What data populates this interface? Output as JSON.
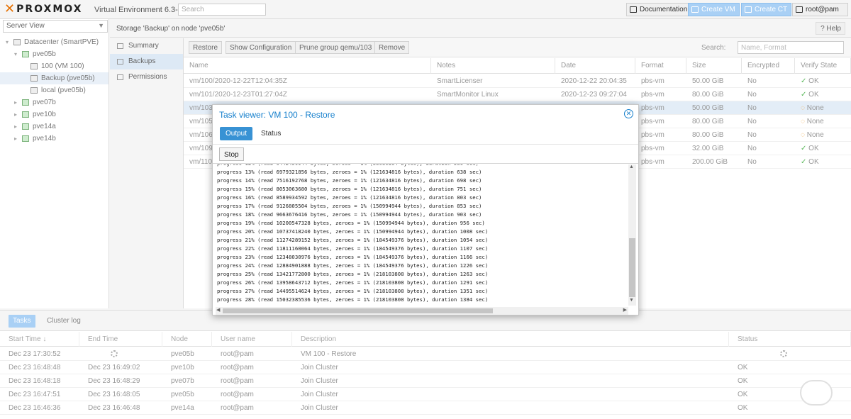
{
  "app": {
    "logo_x": "✕",
    "logo_brand": "PROXMOX",
    "version": "Virtual Environment 6.3-3",
    "search_placeholder": "Search"
  },
  "header": {
    "documentation": "Documentation",
    "create_vm": "Create VM",
    "create_ct": "Create CT",
    "user": "root@pam"
  },
  "sidebar": {
    "view": "Server View",
    "tree": [
      {
        "label": "Datacenter (SmartPVE)",
        "level": 0
      },
      {
        "label": "pve05b",
        "level": 1
      },
      {
        "label": "100 (VM 100)",
        "level": 2
      },
      {
        "label": "Backup (pve05b)",
        "level": 2,
        "selected": true
      },
      {
        "label": "local (pve05b)",
        "level": 2
      },
      {
        "label": "pve07b",
        "level": 1
      },
      {
        "label": "pve10b",
        "level": 1
      },
      {
        "label": "pve14a",
        "level": 1
      },
      {
        "label": "pve14b",
        "level": 1
      }
    ]
  },
  "breadcrumb": "Storage 'Backup' on node 'pve05b'",
  "help": "Help",
  "submenu": [
    "Summary",
    "Backups",
    "Permissions"
  ],
  "toolbar": {
    "restore": "Restore",
    "show_config": "Show Configuration",
    "prune": "Prune group qemu/103",
    "remove": "Remove",
    "search_label": "Search:",
    "search_placeholder": "Name, Format"
  },
  "backups": {
    "columns": [
      "Name",
      "Notes",
      "Date",
      "Format",
      "Size",
      "Encrypted",
      "Verify State"
    ],
    "rows": [
      [
        "vm/100/2020-12-22T12:04:35Z",
        "SmartLicenser",
        "2020-12-22 20:04:35",
        "pbs-vm",
        "50.00 GiB",
        "No",
        "OK"
      ],
      [
        "vm/101/2020-12-23T01:27:04Z",
        "SmartMonitor Linux",
        "2020-12-23 09:27:04",
        "pbs-vm",
        "80.00 GiB",
        "No",
        "OK"
      ],
      [
        "vm/103",
        "",
        "",
        "pbs-vm",
        "50.00 GiB",
        "No",
        "None"
      ],
      [
        "vm/105",
        "",
        "",
        "pbs-vm",
        "80.00 GiB",
        "No",
        "None"
      ],
      [
        "vm/106",
        "",
        "",
        "pbs-vm",
        "80.00 GiB",
        "No",
        "None"
      ],
      [
        "vm/109",
        "",
        "",
        "pbs-vm",
        "32.00 GiB",
        "No",
        "OK"
      ],
      [
        "vm/110",
        "",
        "",
        "pbs-vm",
        "200.00 GiB",
        "No",
        "OK"
      ]
    ]
  },
  "dialog": {
    "title": "Task viewer: VM 100 - Restore",
    "tabs": [
      "Output",
      "Status"
    ],
    "stop": "Stop",
    "log": [
      "progress 12% (read 6442450944 bytes, zeroes = 1% (88080384 bytes), duration 586 sec)",
      "progress 13% (read 6979321856 bytes, zeroes = 1% (121634816 bytes), duration 638 sec)",
      "progress 14% (read 7516192768 bytes, zeroes = 1% (121634816 bytes), duration 698 sec)",
      "progress 15% (read 8053063680 bytes, zeroes = 1% (121634816 bytes), duration 751 sec)",
      "progress 16% (read 8589934592 bytes, zeroes = 1% (121634816 bytes), duration 803 sec)",
      "progress 17% (read 9126805504 bytes, zeroes = 1% (150994944 bytes), duration 853 sec)",
      "progress 18% (read 9663676416 bytes, zeroes = 1% (150994944 bytes), duration 903 sec)",
      "progress 19% (read 10200547328 bytes, zeroes = 1% (150994944 bytes), duration 956 sec)",
      "progress 20% (read 10737418240 bytes, zeroes = 1% (150994944 bytes), duration 1008 sec)",
      "progress 21% (read 11274289152 bytes, zeroes = 1% (184549376 bytes), duration 1054 sec)",
      "progress 22% (read 11811160064 bytes, zeroes = 1% (184549376 bytes), duration 1107 sec)",
      "progress 23% (read 12348030976 bytes, zeroes = 1% (184549376 bytes), duration 1166 sec)",
      "progress 24% (read 12884901888 bytes, zeroes = 1% (184549376 bytes), duration 1226 sec)",
      "progress 25% (read 13421772800 bytes, zeroes = 1% (218103808 bytes), duration 1263 sec)",
      "progress 26% (read 13958643712 bytes, zeroes = 1% (218103808 bytes), duration 1291 sec)",
      "progress 27% (read 14495514624 bytes, zeroes = 1% (218103808 bytes), duration 1351 sec)",
      "progress 28% (read 15032385536 bytes, zeroes = 1% (218103808 bytes), duration 1384 sec)"
    ]
  },
  "tasks": {
    "tabs": [
      "Tasks",
      "Cluster log"
    ],
    "columns": [
      "Start Time ↓",
      "End Time",
      "Node",
      "User name",
      "Description",
      "Status"
    ],
    "rows": [
      [
        "Dec 23 17:30:52",
        "",
        "pve05b",
        "root@pam",
        "VM 100 - Restore",
        ""
      ],
      [
        "Dec 23 16:48:48",
        "Dec 23 16:49:02",
        "pve10b",
        "root@pam",
        "Join Cluster",
        "OK"
      ],
      [
        "Dec 23 16:48:18",
        "Dec 23 16:48:29",
        "pve07b",
        "root@pam",
        "Join Cluster",
        "OK"
      ],
      [
        "Dec 23 16:47:51",
        "Dec 23 16:48:05",
        "pve05b",
        "root@pam",
        "Join Cluster",
        "OK"
      ],
      [
        "Dec 23 16:46:36",
        "Dec 23 16:46:48",
        "pve14a",
        "root@pam",
        "Join Cluster",
        "OK"
      ]
    ]
  },
  "colors": {
    "accent": "#157fcc",
    "button_blue": "#a9d0f5",
    "ok": "#5cb85c",
    "none": "#f0ad4e",
    "orange": "#e57000"
  }
}
